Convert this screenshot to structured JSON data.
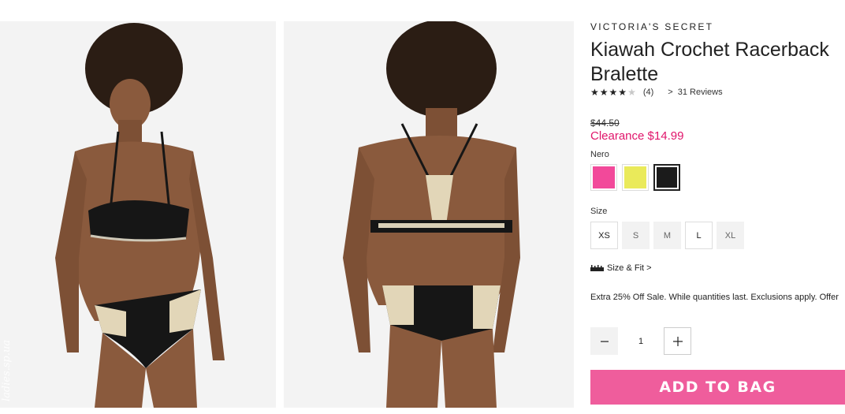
{
  "images": {
    "watermark": "ladies.sp.ua"
  },
  "product": {
    "brand": "VICTORIA'S SECRET",
    "title": "Kiawah Crochet Racerback Bralette",
    "rating": {
      "stars": 4,
      "max": 5,
      "count_text": "(4)",
      "reviews_text": "31 Reviews"
    },
    "original_price": "$44.50",
    "sale_price": "Clearance $14.99",
    "color_name": "Nero",
    "colors": [
      {
        "name": "pink",
        "hex": "#f2499a"
      },
      {
        "name": "yellow",
        "hex": "#eaea5a"
      },
      {
        "name": "black",
        "hex": "#1b1b1b"
      }
    ],
    "size_label": "Size",
    "sizes": [
      "XS",
      "S",
      "M",
      "L",
      "XL"
    ],
    "size_fit": "Size & Fit",
    "promo": "Extra 25% Off Sale. While quantities last. Exclusions apply. Offer",
    "quantity": "1",
    "add_to_bag": "ADD TO BAG",
    "accent": "#ef5d9c",
    "sale_color": "#e0156b"
  }
}
